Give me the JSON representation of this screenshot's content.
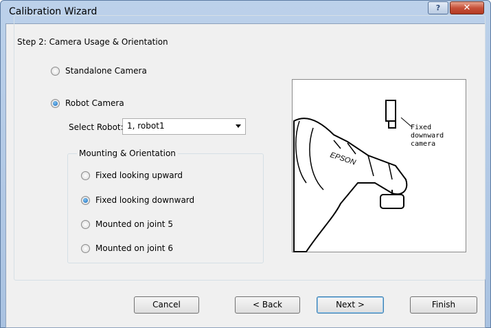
{
  "window": {
    "title": "Calibration Wizard"
  },
  "step": {
    "legend": "Step 2: Camera Usage & Orientation"
  },
  "usage": {
    "standalone_label": "Standalone Camera",
    "robot_label": "Robot Camera",
    "selected": "robot"
  },
  "select_robot": {
    "label": "Select Robot:",
    "value": "1, robot1"
  },
  "mounting": {
    "legend": "Mounting & Orientation",
    "options": [
      {
        "label": "Fixed looking upward",
        "selected": false
      },
      {
        "label": "Fixed looking downward",
        "selected": true
      },
      {
        "label": "Mounted on joint 5",
        "selected": false
      },
      {
        "label": "Mounted on joint 6",
        "selected": false
      }
    ]
  },
  "picture": {
    "caption_lines": [
      "Fixed",
      "downward",
      "camera"
    ],
    "brand": "EPSON"
  },
  "buttons": {
    "cancel": "Cancel",
    "back": "< Back",
    "next": "Next >",
    "finish": "Finish"
  },
  "colors": {
    "radio_on": "#1b6bbd",
    "default_button_border": "#3c7fb1"
  },
  "icons": {
    "help": "question-icon",
    "close": "close-icon"
  }
}
